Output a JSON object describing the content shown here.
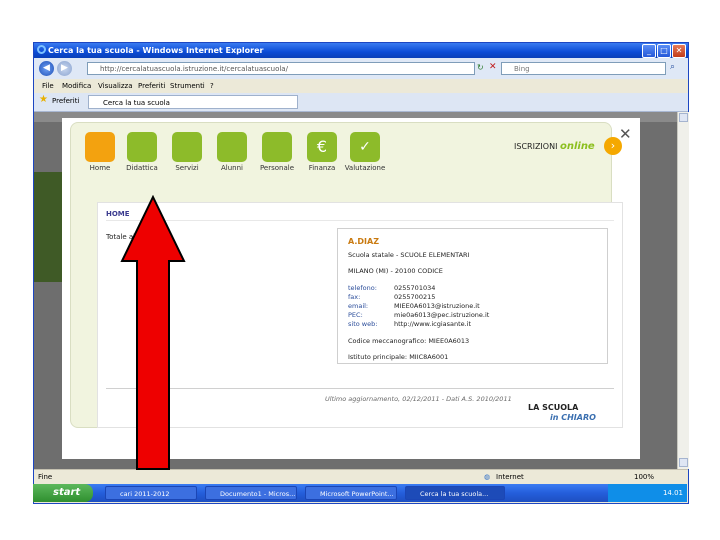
{
  "window": {
    "title": "Cerca la tua scuola - Windows Internet Explorer",
    "minimize": "_",
    "maximize": "□",
    "close": "✕"
  },
  "address": {
    "url": "http://cercalatuascuola.istruzione.it/cercalatuascuola/",
    "search_placeholder": "Bing"
  },
  "menu": [
    "File",
    "Modifica",
    "Visualizza",
    "Preferiti",
    "Strumenti",
    "?"
  ],
  "favorites": {
    "label": "Preferiti",
    "tab": "Cerca la tua scuola"
  },
  "modal": {
    "tiles": [
      {
        "label": "Home",
        "color": "#f3a20f"
      },
      {
        "label": "Didattica",
        "color": "#8dbb2a"
      },
      {
        "label": "Servizi",
        "color": "#8dbb2a"
      },
      {
        "label": "Alunni",
        "color": "#8dbb2a"
      },
      {
        "label": "Personale",
        "color": "#8dbb2a"
      },
      {
        "label": "Finanza",
        "color": "#8dbb2a"
      },
      {
        "label": "Valutazione",
        "color": "#8dbb2a"
      }
    ],
    "iscrizioni_prefix": "ISCRIZIONI",
    "iscrizioni_online": "online",
    "close": "✕",
    "home_title": "HOME",
    "left_text": "Totale alunni: ...le",
    "card": {
      "name": "A.DIAZ",
      "line1": "Scuola statale - SCUOLE ELEMENTARI",
      "line2": "MILANO (MI) - 20100 CODICE",
      "telefono_label": "telefono:",
      "telefono": "0255701034",
      "fax_label": "fax:",
      "fax": "0255700215",
      "email_label": "email:",
      "email": "MIEE0A6013@istruzione.it",
      "pec_label": "PEC:",
      "pec": "mie0a6013@pec.istruzione.it",
      "sito_label": "sito web:",
      "sito": "http://www.icgiasante.it",
      "codice": "Codice meccanografico: MIEE0A6013",
      "istituto": "Istituto principale: MIIC8A6001"
    },
    "updated": "Ultimo aggiornamento, 02/12/2011 - Dati A.S. 2010/2011",
    "logo_line1": "LA SCUOLA",
    "logo_line2": "in CHIARO"
  },
  "status": {
    "left": "Fine",
    "zone": "Internet",
    "zoom": "100%"
  },
  "taskbar": {
    "start": "start",
    "tasks": [
      "cari 2011-2012",
      "Documento1 - Micros...",
      "Microsoft PowerPoint...",
      "Cerca la tua scuola..."
    ],
    "clock": "14.01"
  }
}
